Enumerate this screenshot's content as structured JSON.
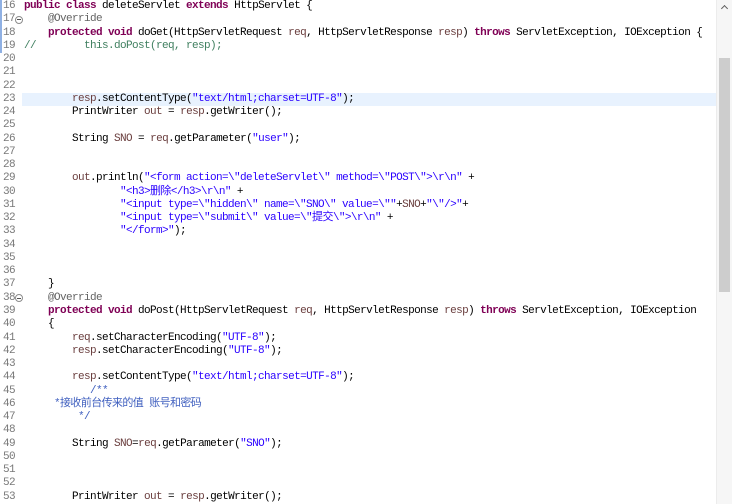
{
  "colors": {
    "background": "#FFFFFF",
    "line_number": "#787878",
    "current_line_highlight": "#E8F2FE"
  },
  "icons": {
    "fold": "fold-collapse-icon",
    "scroll_up": "chevron-up-icon"
  },
  "editor": {
    "current_line": 23,
    "lines": [
      {
        "number": "16",
        "tokens": [
          {
            "text": "public class",
            "color": "#7F0055",
            "bold": true
          },
          {
            "text": " deleteServlet "
          },
          {
            "text": "extends",
            "color": "#7F0055",
            "bold": true
          },
          {
            "text": " HttpServlet {"
          }
        ]
      },
      {
        "number": "17",
        "fold": true,
        "tokens": [
          {
            "text": "    @Override",
            "color": "#646464"
          }
        ]
      },
      {
        "number": "18",
        "tokens": [
          {
            "text": "    protected void",
            "color": "#7F0055",
            "bold": true
          },
          {
            "text": " doGet(HttpServletRequest "
          },
          {
            "text": "req",
            "color": "#6A3E3E"
          },
          {
            "text": ", HttpServletResponse "
          },
          {
            "text": "resp",
            "color": "#6A3E3E"
          },
          {
            "text": ") "
          },
          {
            "text": "throws",
            "color": "#7F0055",
            "bold": true
          },
          {
            "text": " ServletException, IOException {"
          }
        ]
      },
      {
        "number": "19",
        "tokens": [
          {
            "text": "//        this.doPost(req, resp);",
            "color": "#3F7F5F"
          }
        ]
      },
      {
        "number": "20",
        "tokens": []
      },
      {
        "number": "21",
        "tokens": []
      },
      {
        "number": "22",
        "tokens": []
      },
      {
        "number": "23",
        "tokens": [
          {
            "text": "        resp",
            "color": "#6A3E3E"
          },
          {
            "text": ".setContentType("
          },
          {
            "text": "\"text/html;charset=UTF-8\"",
            "color": "#2A00FF"
          },
          {
            "text": ");"
          }
        ]
      },
      {
        "number": "24",
        "tokens": [
          {
            "text": "        PrintWriter "
          },
          {
            "text": "out",
            "color": "#6A3E3E"
          },
          {
            "text": " = "
          },
          {
            "text": "resp",
            "color": "#6A3E3E"
          },
          {
            "text": ".getWriter();"
          }
        ]
      },
      {
        "number": "25",
        "tokens": []
      },
      {
        "number": "26",
        "tokens": [
          {
            "text": "        String "
          },
          {
            "text": "SNO",
            "color": "#6A3E3E"
          },
          {
            "text": " = "
          },
          {
            "text": "req",
            "color": "#6A3E3E"
          },
          {
            "text": ".getParameter("
          },
          {
            "text": "\"user\"",
            "color": "#2A00FF"
          },
          {
            "text": ");"
          }
        ]
      },
      {
        "number": "27",
        "tokens": []
      },
      {
        "number": "28",
        "tokens": []
      },
      {
        "number": "29",
        "tokens": [
          {
            "text": "        out",
            "color": "#6A3E3E"
          },
          {
            "text": ".println("
          },
          {
            "text": "\"<form action=\\\"deleteServlet\\\" method=\\\"POST\\\">\\r\\n\"",
            "color": "#2A00FF"
          },
          {
            "text": " +"
          }
        ]
      },
      {
        "number": "30",
        "tokens": [
          {
            "text": "                \"<h3>删除</h3>\\r\\n\"",
            "color": "#2A00FF"
          },
          {
            "text": " +"
          }
        ]
      },
      {
        "number": "31",
        "tokens": [
          {
            "text": "                \"<input type=\\\"hidden\\\" name=\\\"SNO\\\" value=\\\"\"",
            "color": "#2A00FF"
          },
          {
            "text": "+"
          },
          {
            "text": "SNO",
            "color": "#6A3E3E"
          },
          {
            "text": "+"
          },
          {
            "text": "\"\\\"/>\"",
            "color": "#2A00FF"
          },
          {
            "text": "+"
          }
        ]
      },
      {
        "number": "32",
        "tokens": [
          {
            "text": "                \"<input type=\\\"submit\\\" value=\\\"提交\\\">\\r\\n\"",
            "color": "#2A00FF"
          },
          {
            "text": " +"
          }
        ]
      },
      {
        "number": "33",
        "tokens": [
          {
            "text": "                \"</form>\"",
            "color": "#2A00FF"
          },
          {
            "text": ");"
          }
        ]
      },
      {
        "number": "34",
        "tokens": []
      },
      {
        "number": "35",
        "tokens": []
      },
      {
        "number": "36",
        "tokens": []
      },
      {
        "number": "37",
        "tokens": [
          {
            "text": "    }"
          }
        ]
      },
      {
        "number": "38",
        "fold": true,
        "tokens": [
          {
            "text": "    @Override",
            "color": "#646464"
          }
        ]
      },
      {
        "number": "39",
        "tokens": [
          {
            "text": "    protected void",
            "color": "#7F0055",
            "bold": true
          },
          {
            "text": " doPost(HttpServletRequest "
          },
          {
            "text": "req",
            "color": "#6A3E3E"
          },
          {
            "text": ", HttpServletResponse "
          },
          {
            "text": "resp",
            "color": "#6A3E3E"
          },
          {
            "text": ") "
          },
          {
            "text": "throws",
            "color": "#7F0055",
            "bold": true
          },
          {
            "text": " ServletException, IOException"
          }
        ]
      },
      {
        "number": "40",
        "tokens": [
          {
            "text": "    {"
          }
        ]
      },
      {
        "number": "41",
        "tokens": [
          {
            "text": "        req",
            "color": "#6A3E3E"
          },
          {
            "text": ".setCharacterEncoding("
          },
          {
            "text": "\"UTF-8\"",
            "color": "#2A00FF"
          },
          {
            "text": ");"
          }
        ]
      },
      {
        "number": "42",
        "tokens": [
          {
            "text": "        resp",
            "color": "#6A3E3E"
          },
          {
            "text": ".setCharacterEncoding("
          },
          {
            "text": "\"UTF-8\"",
            "color": "#2A00FF"
          },
          {
            "text": ");"
          }
        ]
      },
      {
        "number": "43",
        "tokens": []
      },
      {
        "number": "44",
        "tokens": [
          {
            "text": "        resp",
            "color": "#6A3E3E"
          },
          {
            "text": ".setContentType("
          },
          {
            "text": "\"text/html;charset=UTF-8\"",
            "color": "#2A00FF"
          },
          {
            "text": ");"
          }
        ]
      },
      {
        "number": "45",
        "tokens": [
          {
            "text": "           /**",
            "color": "#3F5FBF"
          }
        ]
      },
      {
        "number": "46",
        "tokens": [
          {
            "text": "     *接收前台传来的值 账号和密码",
            "color": "#3F5FBF"
          }
        ]
      },
      {
        "number": "47",
        "tokens": [
          {
            "text": "         */",
            "color": "#3F5FBF"
          }
        ]
      },
      {
        "number": "48",
        "tokens": []
      },
      {
        "number": "49",
        "tokens": [
          {
            "text": "        String "
          },
          {
            "text": "SNO",
            "color": "#6A3E3E"
          },
          {
            "text": "="
          },
          {
            "text": "req",
            "color": "#6A3E3E"
          },
          {
            "text": ".getParameter("
          },
          {
            "text": "\"SNO\"",
            "color": "#2A00FF"
          },
          {
            "text": ");"
          }
        ]
      },
      {
        "number": "50",
        "tokens": []
      },
      {
        "number": "51",
        "tokens": []
      },
      {
        "number": "52",
        "tokens": []
      },
      {
        "number": "53",
        "tokens": [
          {
            "text": "        PrintWriter "
          },
          {
            "text": "out",
            "color": "#6A3E3E"
          },
          {
            "text": " = "
          },
          {
            "text": "resp",
            "color": "#6A3E3E"
          },
          {
            "text": ".getWriter();"
          }
        ]
      }
    ]
  }
}
